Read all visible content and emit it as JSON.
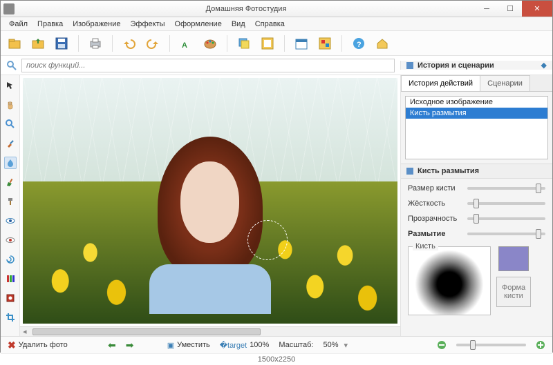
{
  "window": {
    "title": "Домашняя Фотостудия"
  },
  "menu": [
    "Файл",
    "Правка",
    "Изображение",
    "Эффекты",
    "Оформление",
    "Вид",
    "Справка"
  ],
  "search": {
    "placeholder": "поиск функций..."
  },
  "right": {
    "header": "История и сценарии",
    "tabs": [
      "История действий",
      "Сценарии"
    ],
    "history": [
      "Исходное изображение",
      "Кисть размытия"
    ],
    "panel_title": "Кисть размытия"
  },
  "props": {
    "size": "Размер кисти",
    "hard": "Жёсткость",
    "opacity": "Прозрачность",
    "blur": "Размытие",
    "brush_group": "Кисть",
    "shape_btn": "Форма кисти"
  },
  "sliders": {
    "size": 88,
    "hard": 8,
    "opacity": 8,
    "blur": 88
  },
  "status": {
    "delete": "Удалить фото",
    "fit": "Уместить",
    "reset": "100%",
    "scale_label": "Масштаб:",
    "scale_value": "50%"
  },
  "dims": "1500x2250",
  "colors": {
    "swatch": "#8a86c8"
  }
}
